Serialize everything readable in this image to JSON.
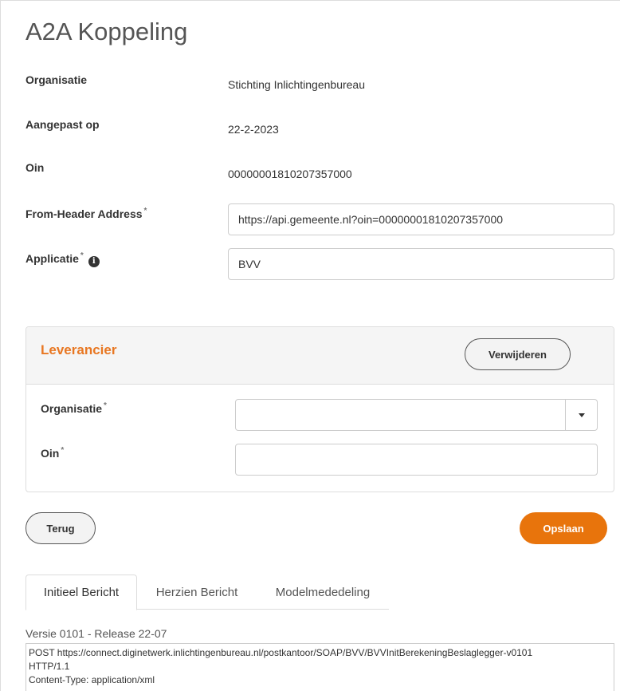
{
  "page": {
    "title": "A2A Koppeling"
  },
  "fields": {
    "organisatie_label": "Organisatie",
    "organisatie_value": "Stichting Inlichtingenbureau",
    "aangepast_label": "Aangepast op",
    "aangepast_value": "22-2-2023",
    "oin_label": "Oin",
    "oin_value": "00000001810207357000",
    "from_header_label": "From-Header Address",
    "from_header_value": "https://api.gemeente.nl?oin=00000001810207357000",
    "applicatie_label": "Applicatie",
    "applicatie_value": "BVV",
    "required_mark": "*",
    "info_glyph": "i"
  },
  "leverancier": {
    "title": "Leverancier",
    "remove_label": "Verwijderen",
    "organisatie_label": "Organisatie",
    "organisatie_value": "",
    "oin_label": "Oin",
    "oin_value": ""
  },
  "actions": {
    "back_label": "Terug",
    "save_label": "Opslaan"
  },
  "tabs": [
    {
      "label": "Initieel Bericht",
      "active": true
    },
    {
      "label": "Herzien Bericht",
      "active": false
    },
    {
      "label": "Modelmededeling",
      "active": false
    }
  ],
  "message": {
    "version": "Versie 0101 - Release 22-07",
    "line1": "POST https://connect.diginetwerk.inlichtingenbureau.nl/postkantoor/SOAP/BVV/BVVInitBerekeningBeslaglegger-v0101",
    "line2": "HTTP/1.1",
    "line3": "Content-Type: application/xml"
  },
  "colors": {
    "accent": "#e8740c",
    "panel_title": "#e87722"
  },
  "icons": {
    "info": "info-circle-icon",
    "dropdown": "caret-down-icon"
  }
}
